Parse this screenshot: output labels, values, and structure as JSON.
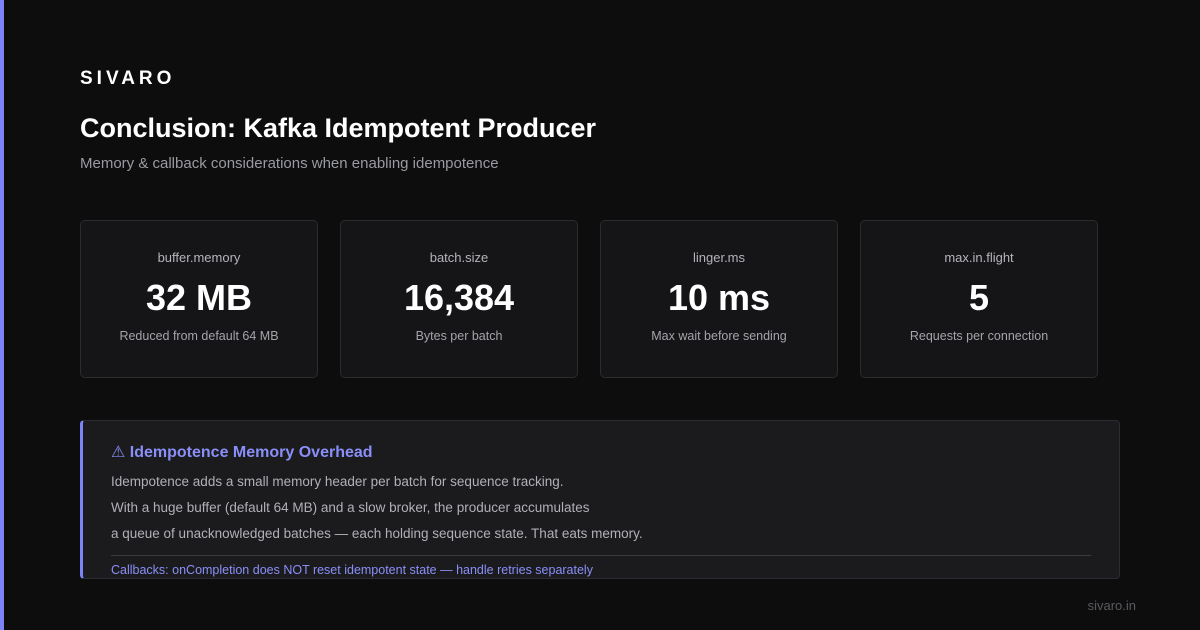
{
  "brand": "SIVARO",
  "title": "Conclusion: Kafka Idempotent Producer",
  "subtitle": "Memory & callback considerations when enabling idempotence",
  "metrics": [
    {
      "label": "buffer.memory",
      "value": "32 MB",
      "caption": "Reduced from default 64 MB"
    },
    {
      "label": "batch.size",
      "value": "16,384",
      "caption": "Bytes per batch"
    },
    {
      "label": "linger.ms",
      "value": "10 ms",
      "caption": "Max wait before sending"
    },
    {
      "label": "max.in.flight",
      "value": "5",
      "caption": "Requests per connection"
    }
  ],
  "note": {
    "title": "⚠ Idempotence Memory Overhead",
    "lines": [
      "Idempotence adds a small memory header per batch for sequence tracking.",
      "With a huge buffer (default 64 MB) and a slow broker, the producer accumulates",
      "a queue of unacknowledged batches — each holding sequence state. That eats memory."
    ],
    "footer": "Callbacks: onCompletion does NOT reset idempotent state — handle retries separately"
  },
  "site": "sivaro.in",
  "colors": {
    "background": "#0d0d0e",
    "accent": "#7c83f5",
    "card": "#151517",
    "note": "#1b1b1e"
  }
}
